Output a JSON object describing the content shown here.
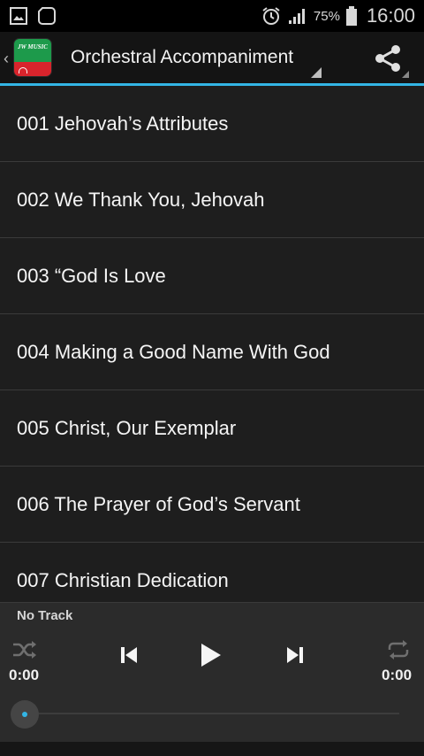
{
  "status_bar": {
    "icons_left": [
      "gallery-notification-icon",
      "app-notification-icon"
    ],
    "icons_right": [
      "alarm-icon",
      "signal-icon",
      "battery-icon"
    ],
    "battery_percent": "75%",
    "time": "16:00"
  },
  "action_bar": {
    "title": "Orchestral Accompaniment",
    "app_icon_text": "JW MUSIC",
    "accent_color": "#33b5e5"
  },
  "tracks": [
    "001 Jehovah’s Attributes",
    "002 We Thank You, Jehovah",
    "003 “God Is Love",
    "004 Making a Good Name With God",
    "005 Christ, Our Exemplar",
    "006 The Prayer of God’s Servant",
    "007 Christian Dedication"
  ],
  "player": {
    "now_playing": "No Track",
    "elapsed": "0:00",
    "duration": "0:00",
    "progress": 0
  }
}
